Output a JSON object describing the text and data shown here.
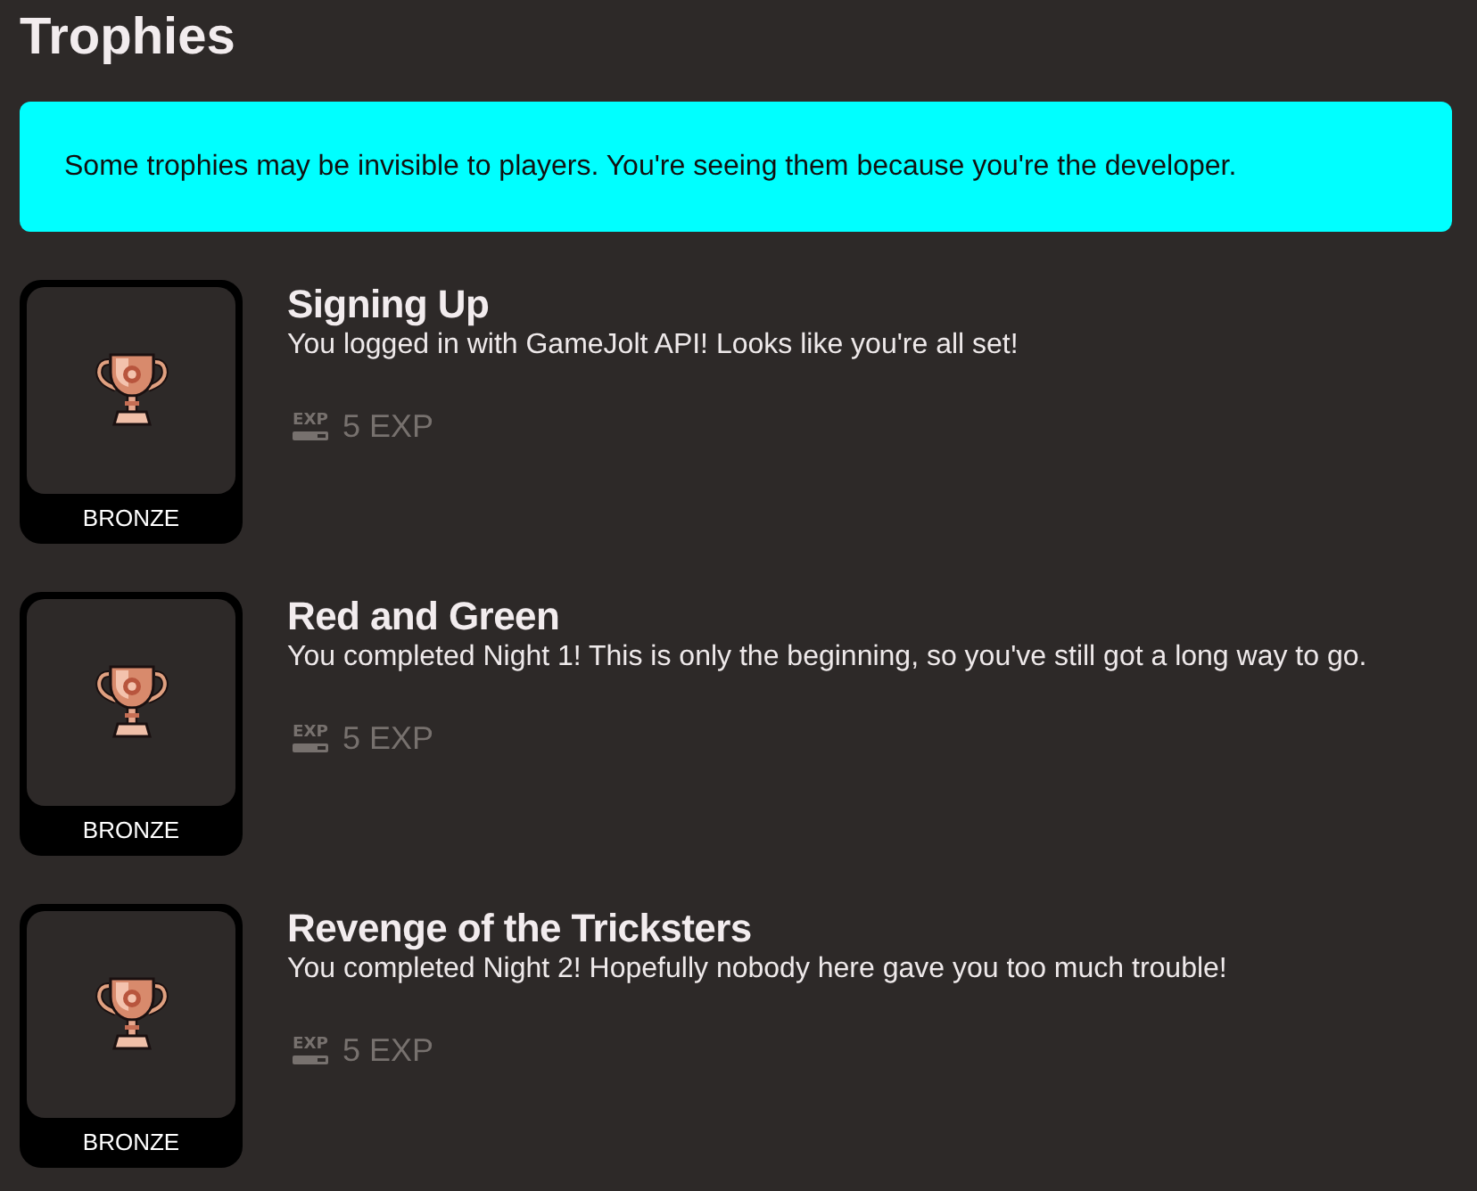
{
  "page": {
    "title": "Trophies"
  },
  "notice": {
    "text": "Some trophies may be invisible to players. You're seeing them because you're the developer."
  },
  "trophies": [
    {
      "title": "Signing Up",
      "description": "You logged in with GameJolt API! Looks like you're all set!",
      "tier": "BRONZE",
      "exp_icon_text": "EXP",
      "exp": "5 EXP"
    },
    {
      "title": "Red and Green",
      "description": "You completed Night 1! This is only the beginning, so you've still got a long way to go.",
      "tier": "BRONZE",
      "exp_icon_text": "EXP",
      "exp": "5 EXP"
    },
    {
      "title": "Revenge of the Tricksters",
      "description": "You completed Night 2! Hopefully nobody here gave you too much trouble!",
      "tier": "BRONZE",
      "exp_icon_text": "EXP",
      "exp": "5 EXP"
    }
  ]
}
